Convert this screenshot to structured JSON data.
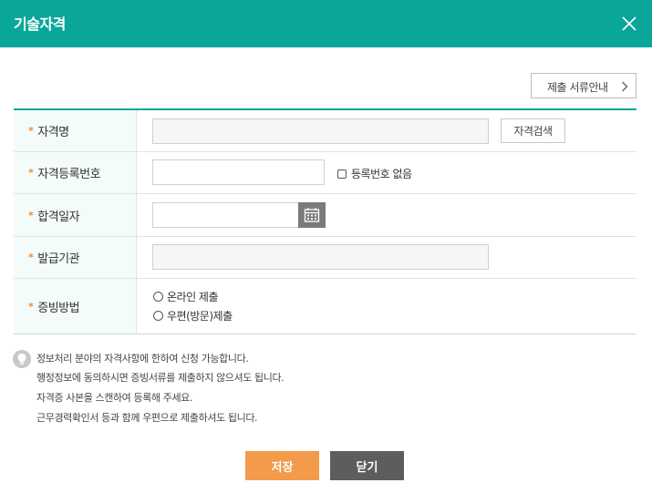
{
  "header": {
    "title": "기술자격",
    "close_icon": "close-icon"
  },
  "guide_button": {
    "label": "제출 서류안내",
    "icon": "chevron-right-icon"
  },
  "form": {
    "rows": [
      {
        "label": "자격명",
        "required": "*",
        "input_value": "",
        "search_button": "자격검색"
      },
      {
        "label": "자격등록번호",
        "required": "*",
        "input_value": "",
        "checkbox_label": "등록번호 없음"
      },
      {
        "label": "합격일자",
        "required": "*",
        "input_value": "",
        "calendar_icon": "calendar-icon"
      },
      {
        "label": "발급기관",
        "required": "*",
        "input_value": ""
      },
      {
        "label": "증빙방법",
        "required": "*",
        "options": [
          "온라인 제출",
          "우편(방문)제출"
        ]
      }
    ]
  },
  "notice": {
    "icon": "lightbulb-icon",
    "lines": [
      "정보처리 분야의 자격사항에 한하여 신청 가능합니다.",
      "행정정보에 동의하시면 증빙서류를 제출하지 않으셔도 됩니다.",
      "자격증 사본을 스캔하여 등록해 주세요.",
      "근무경력확인서 등과 함께 우편으로 제출하셔도 됩니다."
    ]
  },
  "buttons": {
    "save": "저장",
    "close": "닫기"
  },
  "colors": {
    "header": "#0aa69a",
    "save": "#f39a4b",
    "close": "#5d5d5d",
    "required": "#f08c2b"
  }
}
